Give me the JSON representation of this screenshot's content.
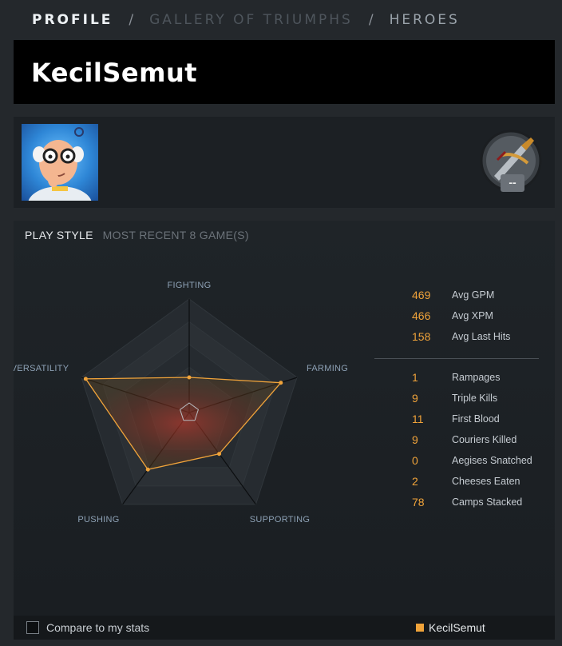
{
  "nav": {
    "profile": "PROFILE",
    "sep1": "/",
    "gallery": "GALLERY OF TRIUMPHS",
    "sep2": "/",
    "heroes": "HEROES"
  },
  "player": {
    "name": "KecilSemut"
  },
  "rank": {
    "label": "--"
  },
  "playstyle": {
    "title": "PLAY STYLE",
    "subtitle": "MOST RECENT 8 GAME(S)",
    "axes": [
      {
        "name": "FIGHTING",
        "value": 0.31
      },
      {
        "name": "FARMING",
        "value": 0.85
      },
      {
        "name": "SUPPORTING",
        "value": 0.45
      },
      {
        "name": "PUSHING",
        "value": 0.62
      },
      {
        "name": "VERSATILITY",
        "value": 0.96
      }
    ]
  },
  "stats_primary": [
    {
      "value": "469",
      "label": "Avg GPM"
    },
    {
      "value": "466",
      "label": "Avg XPM"
    },
    {
      "value": "158",
      "label": "Avg Last Hits"
    }
  ],
  "stats_secondary": [
    {
      "value": "1",
      "label": "Rampages"
    },
    {
      "value": "9",
      "label": "Triple Kills"
    },
    {
      "value": "11",
      "label": "First Blood"
    },
    {
      "value": "9",
      "label": "Couriers Killed"
    },
    {
      "value": "0",
      "label": "Aegises Snatched"
    },
    {
      "value": "2",
      "label": "Cheeses Eaten"
    },
    {
      "value": "78",
      "label": "Camps Stacked"
    }
  ],
  "footer": {
    "compare_label": "Compare to my stats",
    "compare_checked": false,
    "legend_label": "KecilSemut"
  },
  "colors": {
    "accent": "#f0a33a",
    "bg": "#24282c",
    "panel": "#1c2125"
  }
}
